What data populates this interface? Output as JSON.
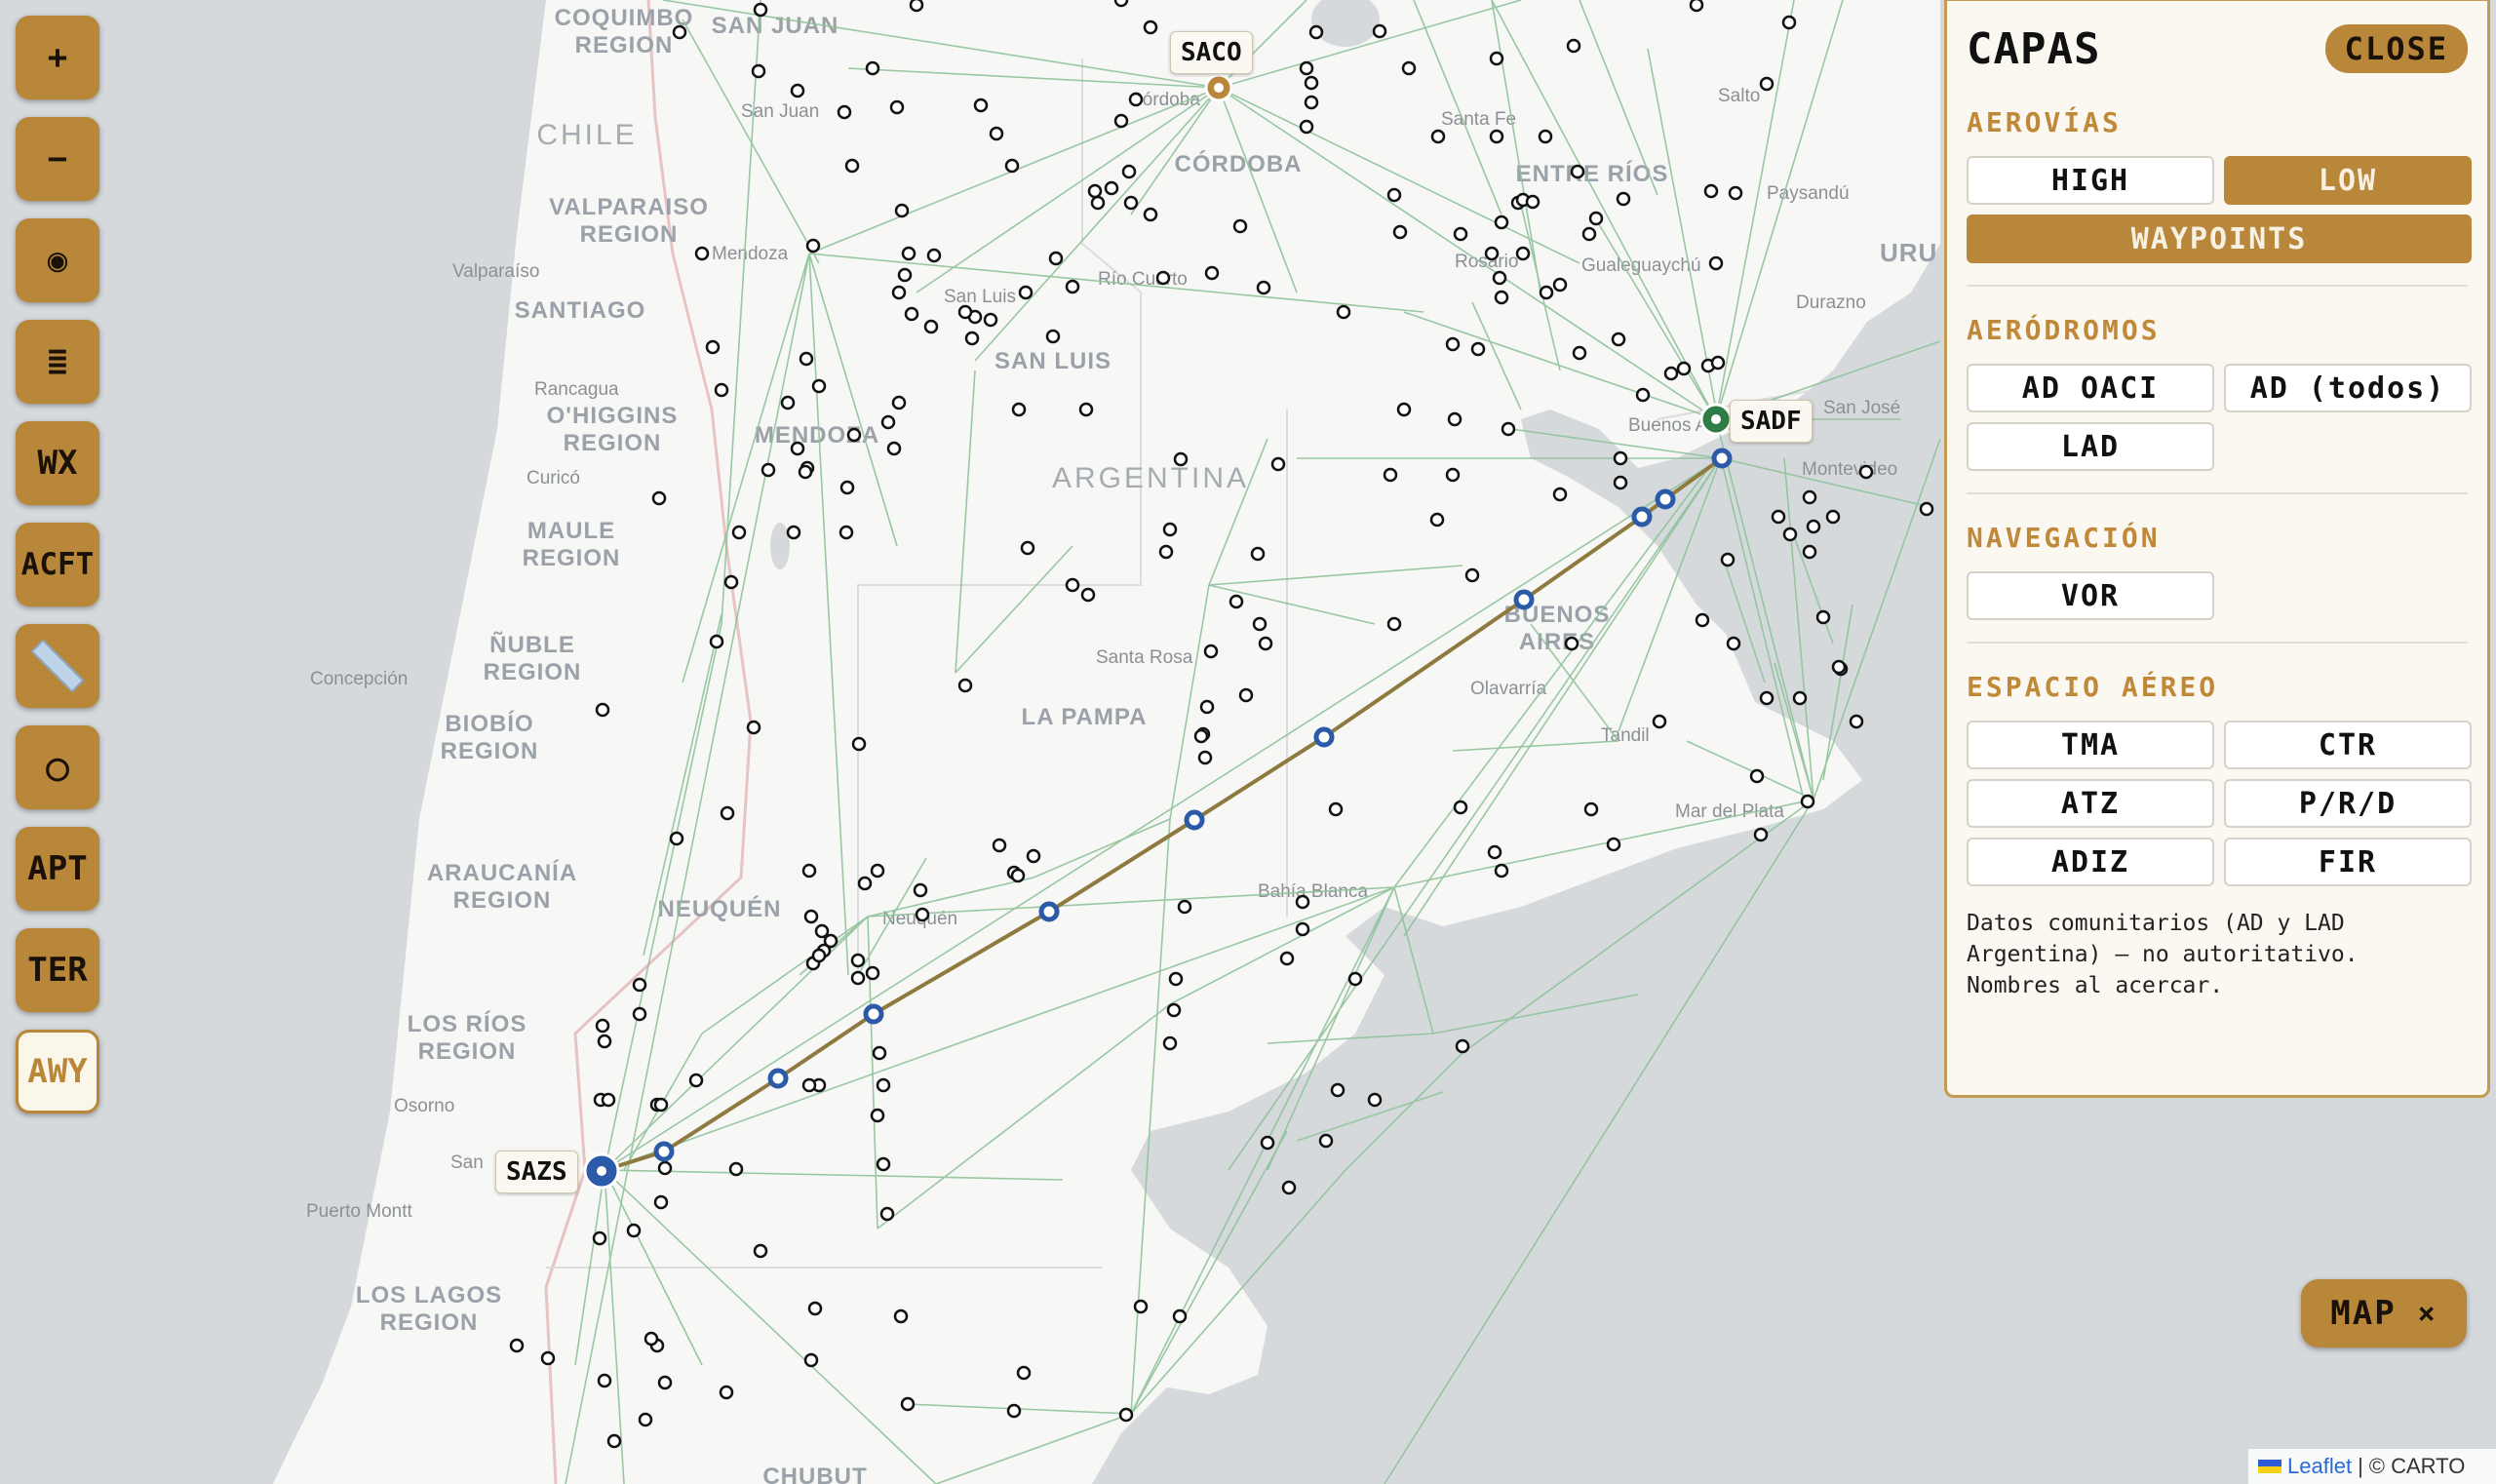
{
  "toolbar": {
    "items": [
      {
        "id": "zoom-in",
        "label": "+",
        "icon": "plus-icon"
      },
      {
        "id": "zoom-out",
        "label": "−",
        "icon": "minus-icon"
      },
      {
        "id": "locate",
        "label": "◉",
        "icon": "target-icon"
      },
      {
        "id": "list",
        "label": "≣",
        "icon": "list-icon"
      },
      {
        "id": "wx",
        "label": "WX"
      },
      {
        "id": "acft",
        "label": "ACFT"
      },
      {
        "id": "ruler",
        "label": "",
        "icon": "ruler-icon"
      },
      {
        "id": "circle",
        "label": "○",
        "icon": "circle-icon"
      },
      {
        "id": "apt",
        "label": "APT"
      },
      {
        "id": "ter",
        "label": "TER"
      },
      {
        "id": "awy",
        "label": "AWY",
        "active": true
      }
    ]
  },
  "waypoint_labels": {
    "saco": "SACO",
    "sadf": "SADF",
    "sazs": "SAZS"
  },
  "panel": {
    "title": "CAPAS",
    "close": "CLOSE",
    "sections": {
      "aerovias": {
        "title": "AEROVÍAS",
        "high": "HIGH",
        "low": "LOW",
        "waypoints": "WAYPOINTS"
      },
      "aerodromos": {
        "title": "AERÓDROMOS",
        "ad_oaci": "AD OACI",
        "ad_todos": "AD (todos)",
        "lad": "LAD"
      },
      "navegacion": {
        "title": "NAVEGACIÓN",
        "vor": "VOR"
      },
      "espacio": {
        "title": "ESPACIO AÉREO",
        "tma": "TMA",
        "ctr": "CTR",
        "atz": "ATZ",
        "prd": "P/R/D",
        "adiz": "ADIZ",
        "fir": "FIR"
      }
    },
    "note": [
      "Datos comunitarios (AD y LAD",
      "Argentina) — no autoritativo.",
      "Nombres al acercar."
    ]
  },
  "map_toggle": {
    "label": "MAP",
    "icon": "close-icon",
    "glyph": "×"
  },
  "attribution": {
    "leaflet": "Leaflet",
    "sep": " | ",
    "carto": "© CARTO"
  },
  "map_labels": {
    "regions": [
      {
        "lines": [
          "COQUIMBO",
          "REGION"
        ]
      },
      {
        "lines": [
          "SAN JUAN"
        ]
      },
      {
        "lines": [
          "CHILE"
        ]
      },
      {
        "lines": [
          "CÓRDOBA"
        ]
      },
      {
        "lines": [
          "VALPARAISO",
          "REGION"
        ]
      },
      {
        "lines": [
          "ENTRE RÍOS"
        ]
      },
      {
        "lines": [
          "SANTIAGO"
        ]
      },
      {
        "lines": [
          "SAN LUIS"
        ]
      },
      {
        "lines": [
          "O'HIGGINS",
          "REGION"
        ]
      },
      {
        "lines": [
          "MENDOZA"
        ]
      },
      {
        "lines": [
          "ARGENTINA"
        ]
      },
      {
        "lines": [
          "MAULE",
          "REGION"
        ]
      },
      {
        "lines": [
          "BUENOS",
          "AIRES"
        ]
      },
      {
        "lines": [
          "ÑUBLE",
          "REGION"
        ]
      },
      {
        "lines": [
          "BIOBÍO",
          "REGION"
        ]
      },
      {
        "lines": [
          "LA PAMPA"
        ]
      },
      {
        "lines": [
          "ARAUCANÍA",
          "REGION"
        ]
      },
      {
        "lines": [
          "NEUQUÉN"
        ]
      },
      {
        "lines": [
          "LOS RÍOS",
          "REGION"
        ]
      },
      {
        "lines": [
          "LOS LAGOS",
          "REGION"
        ]
      },
      {
        "lines": [
          "URU"
        ]
      },
      {
        "lines": [
          "CHUBUT"
        ]
      }
    ],
    "cities": [
      "Córdoba",
      "San Juan",
      "Santa Fe",
      "Salto",
      "Paysandú",
      "Mendoza",
      "Valparaíso",
      "Rosario",
      "Gualeguaychú",
      "Río Cuarto",
      "San Luis",
      "Durazno",
      "Rancagua",
      "San José",
      "Buenos Aires",
      "Montevideo",
      "Curicó",
      "Santa Rosa",
      "Olavarría",
      "Concepción",
      "Tandil",
      "Mar del Plata",
      "Bahía Blanca",
      "Neuquén",
      "Osorno",
      "San",
      "Puerto Montt"
    ]
  },
  "colors": {
    "accent": "#b8873a",
    "route": "#8e7a3e",
    "airway": "#8fc29a",
    "waypoint_active": "#2b5aa8",
    "sadf": "#2e7d46",
    "land": "#f7f7f5",
    "sea": "#d6d9dc"
  }
}
